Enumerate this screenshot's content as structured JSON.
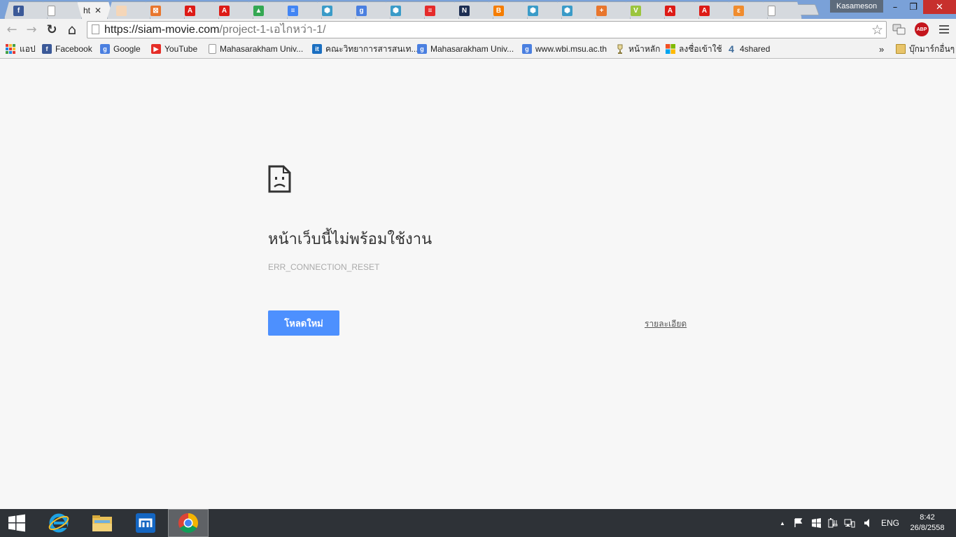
{
  "window": {
    "profile_name": "Kasameson",
    "minimize_label": "–",
    "maximize_label": "❐",
    "close_label": "✕"
  },
  "tabs": {
    "active_title": "ht",
    "close_label": "✕",
    "favicons": [
      {
        "name": "facebook",
        "color": "#3b5998",
        "glyph": "f"
      },
      {
        "name": "blank-page",
        "color": "#ffffff",
        "glyph": ""
      },
      {
        "name": "active",
        "color": "",
        "glyph": ""
      },
      {
        "name": "cat-face",
        "color": "#f5d6b8",
        "glyph": ""
      },
      {
        "name": "xampp",
        "color": "#e8762d",
        "glyph": "⊠"
      },
      {
        "name": "angularjs",
        "color": "#dd1b16",
        "glyph": "A"
      },
      {
        "name": "angularjs",
        "color": "#dd1b16",
        "glyph": "A"
      },
      {
        "name": "google-drive",
        "color": "#34a853",
        "glyph": "▲"
      },
      {
        "name": "google-docs",
        "color": "#4285f4",
        "glyph": "≡"
      },
      {
        "name": "hexagon-app",
        "color": "#3a9bc8",
        "glyph": "⬢"
      },
      {
        "name": "google",
        "color": "#4a7fe0",
        "glyph": "g"
      },
      {
        "name": "hexagon-app",
        "color": "#3a9bc8",
        "glyph": "⬢"
      },
      {
        "name": "thai-flag",
        "color": "#e52b2b",
        "glyph": "≡"
      },
      {
        "name": "n-logo",
        "color": "#1c2d52",
        "glyph": "N"
      },
      {
        "name": "blogger",
        "color": "#f57d00",
        "glyph": "B"
      },
      {
        "name": "hexagon-app",
        "color": "#3a9bc8",
        "glyph": "⬢"
      },
      {
        "name": "hexagon-app",
        "color": "#3a9bc8",
        "glyph": "⬢"
      },
      {
        "name": "plus-app",
        "color": "#e8762d",
        "glyph": "+"
      },
      {
        "name": "v-logo",
        "color": "#9bc53d",
        "glyph": "V"
      },
      {
        "name": "angularjs",
        "color": "#dd1b16",
        "glyph": "A"
      },
      {
        "name": "angularjs",
        "color": "#dd1b16",
        "glyph": "A"
      },
      {
        "name": "orange-app",
        "color": "#f08c2e",
        "glyph": "ε"
      },
      {
        "name": "blank-page",
        "color": "#ffffff",
        "glyph": ""
      }
    ]
  },
  "toolbar": {
    "back": "←",
    "forward": "→",
    "reload": "↻",
    "home": "⌂",
    "url_host": "https://siam-movie.com",
    "url_path": "/project-1-เอไกหว่า-1/",
    "star": "☆",
    "abp_label": "ABP"
  },
  "bookmarks": {
    "items": [
      {
        "label": "แอป",
        "icon": "apps-grid-icon",
        "color": ""
      },
      {
        "label": "Facebook",
        "icon": "facebook-icon",
        "color": "#3b5998",
        "glyph": "f"
      },
      {
        "label": "Google",
        "icon": "google-icon",
        "color": "#4a7fe0",
        "glyph": "g"
      },
      {
        "label": "YouTube",
        "icon": "youtube-icon",
        "color": "#e52d27",
        "glyph": "▶"
      },
      {
        "label": "Mahasarakham Univ...",
        "icon": "page-icon",
        "color": "",
        "glyph": ""
      },
      {
        "label": "คณะวิทยาการสารสนเท...",
        "icon": "it-icon",
        "color": "#1b6fc1",
        "glyph": "it"
      },
      {
        "label": "Mahasarakham Univ...",
        "icon": "google-icon",
        "color": "#4a7fe0",
        "glyph": "g"
      },
      {
        "label": "www.wbi.msu.ac.th",
        "icon": "google-icon",
        "color": "#4a7fe0",
        "glyph": "g"
      },
      {
        "label": "หน้าหลัก",
        "icon": "trophy-icon",
        "color": "",
        "glyph": ""
      },
      {
        "label": "ลงชื่อเข้าใช้",
        "icon": "windows-logo-icon",
        "color": "",
        "glyph": ""
      },
      {
        "label": "4shared",
        "icon": "4shared-icon",
        "color": "#3d6a99",
        "glyph": "4"
      }
    ],
    "overflow": "»",
    "other_bookmarks": "บุ๊กมาร์กอื่นๆ"
  },
  "error": {
    "title": "หน้าเว็บนี้ไม่พร้อมใช้งาน",
    "code": "ERR_CONNECTION_RESET",
    "reload_button": "โหลดใหม่",
    "details_link": "รายละเอียด"
  },
  "taskbar": {
    "tray_arrow": "▲",
    "language": "ENG",
    "time": "8:42",
    "date": "26/8/2558"
  }
}
